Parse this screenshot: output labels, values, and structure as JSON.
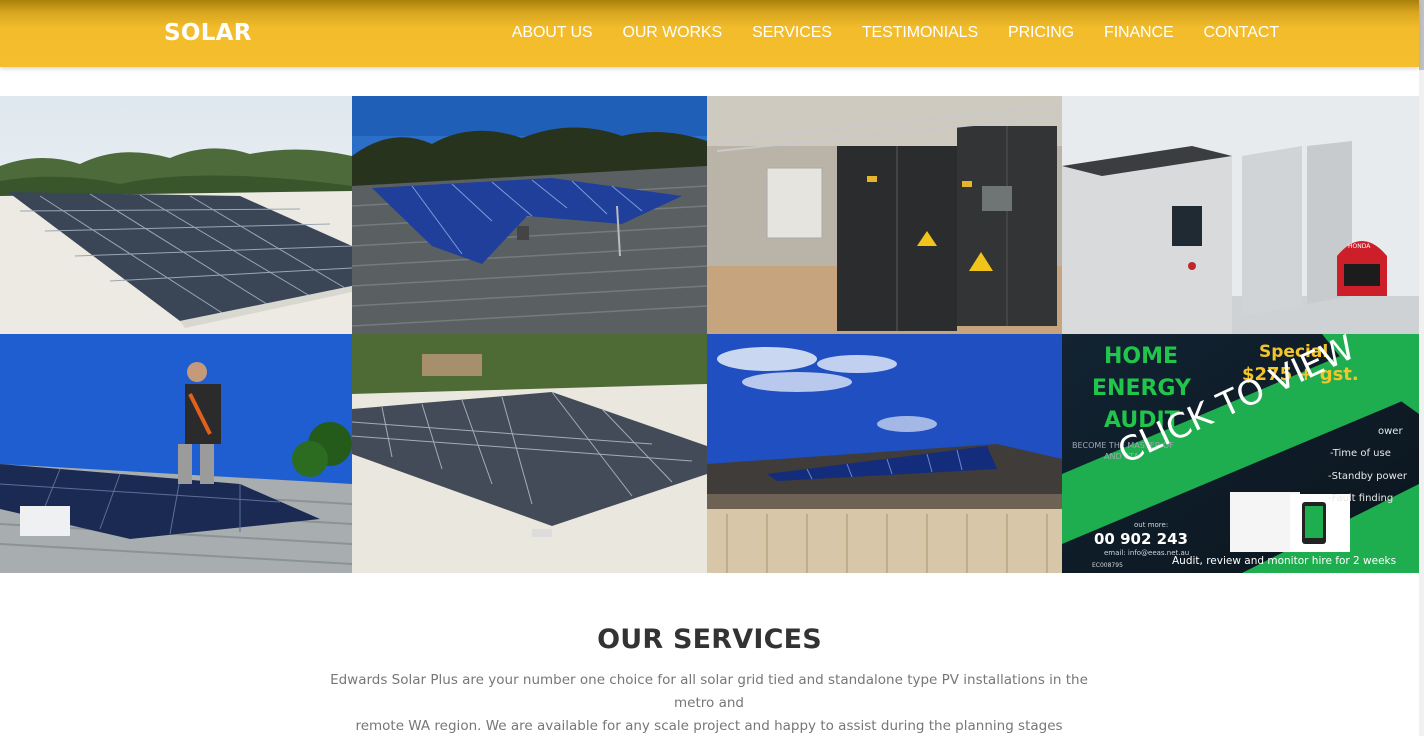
{
  "header": {
    "logo": "SOLAR",
    "nav": [
      "ABOUT US",
      "OUR WORKS",
      "SERVICES",
      "TESTIMONIALS",
      "PRICING",
      "FINANCE",
      "CONTACT"
    ]
  },
  "gallery": {
    "promo": {
      "line1": "HOME",
      "line2": "ENERGY",
      "line3": "AUDIT",
      "special": "Special",
      "price": "$275 + gst.",
      "banner": "CLICK TO VIEW",
      "master": "BECOME THE MASTER OF",
      "master2": "AND STA",
      "bullet1": "ower",
      "bullet2": "-Time of use",
      "bullet3": "-Standby power",
      "bullet4": "-Fault finding",
      "find_more": "out more:",
      "phone": "00 902 243",
      "email": "email: info@eeas.net.au",
      "license": "EC008795",
      "footer": "Audit, review and monitor hire for 2 weeks"
    },
    "generator_brand": "HONDA"
  },
  "services": {
    "title": "OUR SERVICES",
    "text_line1": "Edwards Solar Plus are your number one choice for all solar grid tied and standalone type PV installations in the metro and",
    "text_line2": "remote WA region. We are available for any scale project and happy to assist during the planning stages"
  },
  "colors": {
    "header": "#f4be2e",
    "promo_green": "#1fae4f",
    "promo_dark": "#0d1a24",
    "text_dark": "#333333",
    "text_muted": "#777777"
  }
}
